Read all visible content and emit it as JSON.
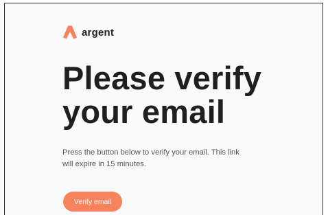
{
  "brand": {
    "name": "argent",
    "logo_icon": "argent-logo-icon",
    "accent_color": "#f7835c"
  },
  "email": {
    "headline_line1": "Please verify",
    "headline_line2": "your email",
    "body_line1": "Press the button below to verify your email. This link",
    "body_line2": "will expire in 15 minutes.",
    "button_label": "Verify email"
  }
}
